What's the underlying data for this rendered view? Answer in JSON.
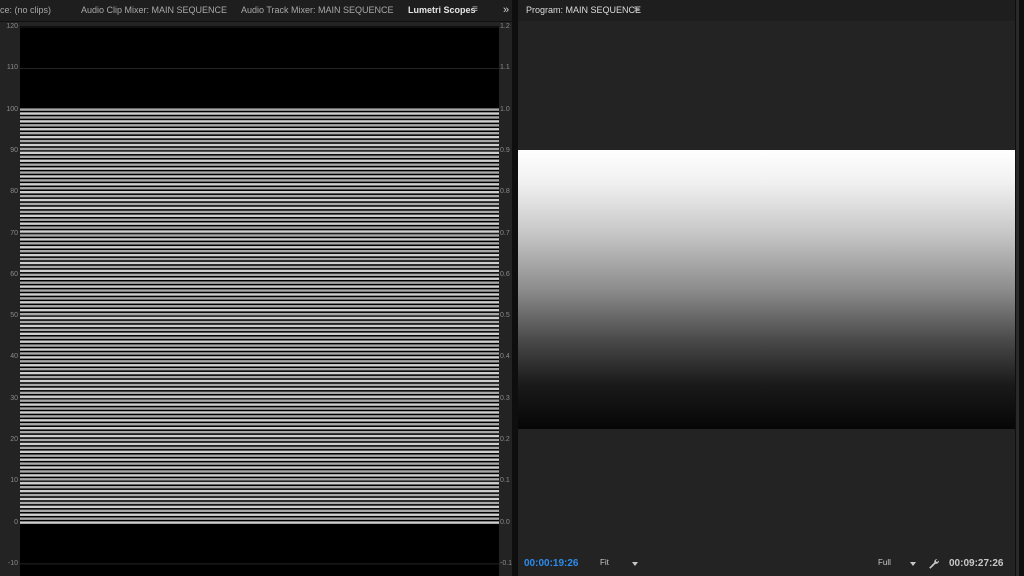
{
  "left_tabs": [
    {
      "label": "ce: (no clips)"
    },
    {
      "label": "Audio Clip Mixer: MAIN SEQUENCE"
    },
    {
      "label": "Audio Track Mixer: MAIN SEQUENCE"
    },
    {
      "label": "Lumetri Scopes",
      "active": true
    }
  ],
  "menu_glyph": "≡",
  "overflow_glyph": "»",
  "scope": {
    "left_ticks": [
      "120",
      "110",
      "100",
      "90",
      "80",
      "70",
      "60",
      "50",
      "40",
      "30",
      "20",
      "10",
      "0",
      "-10"
    ],
    "right_ticks": [
      "1.2",
      "1.1",
      "1.0",
      "0.9",
      "0.8",
      "0.7",
      "0.6",
      "0.5",
      "0.4",
      "0.3",
      "0.2",
      "0.1",
      "0.0",
      "-0.1"
    ]
  },
  "program": {
    "title": "Program: MAIN SEQUENCE",
    "current_timecode": "00:00:19:26",
    "duration_timecode": "00:09:27:26",
    "zoom": "Fit",
    "resolution": "Full"
  },
  "colors": {
    "timecode_accent": "#2d8ceb",
    "panel_bg": "#232323",
    "scope_bg": "#000000"
  },
  "icons": [
    "panel-menu-icon",
    "overflow-icon",
    "dropdown-arrow-icon",
    "wrench-icon"
  ]
}
